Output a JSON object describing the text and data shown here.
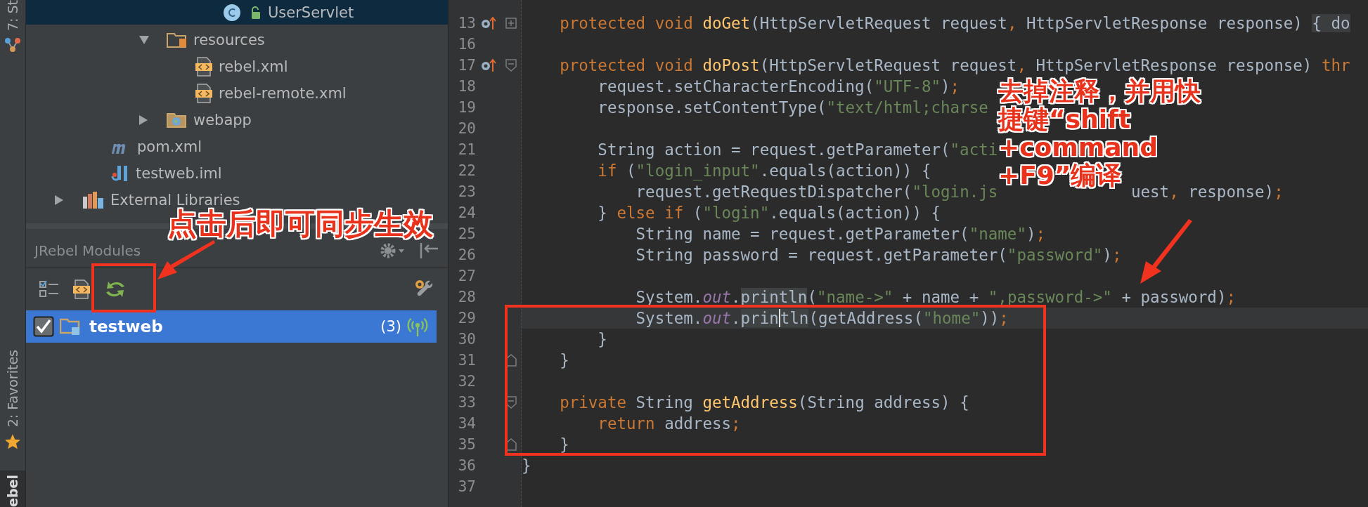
{
  "tool_strip": [
    {
      "label": "7: St",
      "selected": false
    },
    {
      "label": "2: Favorites",
      "selected": false
    },
    {
      "label": "ebel",
      "selected": true
    }
  ],
  "project_tree": [
    {
      "children": [
        {
          "children": [
            {
              "children": [
                {
                  "children": [
                    {
                      "children": [
                        {
                          "label": "UserServlet",
                          "kind": "class",
                          "selected": true
                        }
                      ]
                    }
                  ]
                },
                {
                  "label": "resources",
                  "kind": "resources",
                  "expanded": true,
                  "selected": false,
                  "children": [
                    {
                      "label": "rebel.xml",
                      "kind": "xml",
                      "selected": false
                    },
                    {
                      "label": "rebel-remote.xml",
                      "kind": "xml",
                      "selected": false
                    }
                  ]
                },
                {
                  "label": "webapp",
                  "kind": "web",
                  "expanded": false,
                  "selected": false
                }
              ]
            }
          ]
        },
        {
          "label": "pom.xml",
          "kind": "maven",
          "selected": false
        },
        {
          "label": "testweb.iml",
          "kind": "iml",
          "selected": false
        }
      ]
    },
    {
      "label": "External Libraries",
      "kind": "libraries",
      "expanded": false,
      "selected": false
    }
  ],
  "modules_panel": {
    "title": "JRebel Modules",
    "modules": [
      {
        "name": "testweb",
        "count": "(3)",
        "checked": true,
        "selected": true
      }
    ]
  },
  "editor": {
    "lines": [
      {
        "number": "13",
        "override": true,
        "fold": {
          "kind": "plus"
        },
        "tokens": [
          {
            "kind": "kw",
            "t": "    protected void "
          },
          {
            "kind": "decl",
            "t": "doGet"
          },
          {
            "kind": "p",
            "t": "(HttpServletRequest request"
          },
          {
            "kind": "kw",
            "t": ", "
          },
          {
            "kind": "p",
            "t": "HttpServletResponse response) "
          },
          {
            "kind": "folded",
            "t": "{ do"
          }
        ]
      },
      {
        "number": "16"
      },
      {
        "number": "17",
        "override": true,
        "fold": {
          "kind": "start"
        },
        "tokens": [
          {
            "kind": "kw",
            "t": "    protected void "
          },
          {
            "kind": "decl",
            "t": "doPost"
          },
          {
            "kind": "p",
            "t": "(HttpServletRequest request"
          },
          {
            "kind": "kw",
            "t": ", "
          },
          {
            "kind": "p",
            "t": "HttpServletResponse response) "
          },
          {
            "kind": "kw",
            "t": "thr"
          }
        ]
      },
      {
        "number": "18",
        "tokens": [
          {
            "kind": "p",
            "t": "        request.setCharacterEncoding("
          },
          {
            "kind": "str",
            "t": "\"UTF-8\""
          },
          {
            "kind": "p",
            "t": ")"
          },
          {
            "kind": "kw",
            "t": ";"
          }
        ]
      },
      {
        "number": "19",
        "tokens": [
          {
            "kind": "p",
            "t": "        response.setContentType("
          },
          {
            "kind": "str",
            "t": "\"text/html;charse"
          }
        ]
      },
      {
        "number": "20"
      },
      {
        "number": "21",
        "tokens": [
          {
            "kind": "p",
            "t": "        String action = request.getParameter("
          },
          {
            "kind": "str",
            "t": "\"acti"
          }
        ]
      },
      {
        "number": "22",
        "tokens": [
          {
            "kind": "kw",
            "t": "        if "
          },
          {
            "kind": "p",
            "t": "("
          },
          {
            "kind": "str",
            "t": "\"login_input\""
          },
          {
            "kind": "p",
            "t": ".equals(action)) {"
          }
        ]
      },
      {
        "number": "23",
        "tokens": [
          {
            "kind": "p",
            "t": "            request.getRequestDispatcher("
          },
          {
            "kind": "str",
            "t": "\"login.js"
          }
        ],
        "tail": [
          {
            "kind": "p",
            "t": "uest"
          },
          {
            "kind": "kw",
            "t": ", "
          },
          {
            "kind": "p",
            "t": "response)"
          },
          {
            "kind": "kw",
            "t": ";"
          }
        ]
      },
      {
        "number": "24",
        "tokens": [
          {
            "kind": "p",
            "t": "        } "
          },
          {
            "kind": "kw",
            "t": "else if "
          },
          {
            "kind": "p",
            "t": "("
          },
          {
            "kind": "str",
            "t": "\"login\""
          },
          {
            "kind": "p",
            "t": ".equals(action)) {"
          }
        ]
      },
      {
        "number": "25",
        "tokens": [
          {
            "kind": "p",
            "t": "            String name = request.getParameter("
          },
          {
            "kind": "str",
            "t": "\"name\""
          },
          {
            "kind": "p",
            "t": ")"
          },
          {
            "kind": "kw",
            "t": ";"
          }
        ]
      },
      {
        "number": "26",
        "tokens": [
          {
            "kind": "p",
            "t": "            String password = request.getParameter("
          },
          {
            "kind": "str",
            "t": "\"password\""
          },
          {
            "kind": "p",
            "t": ")"
          },
          {
            "kind": "kw",
            "t": ";"
          }
        ]
      },
      {
        "number": "27"
      },
      {
        "number": "28",
        "tokens": [
          {
            "kind": "p",
            "t": "            System."
          },
          {
            "kind": "field",
            "t": "out"
          },
          {
            "kind": "p",
            "t": "."
          },
          {
            "kind": "match",
            "t": "println"
          },
          {
            "kind": "p",
            "t": "("
          },
          {
            "kind": "str",
            "t": "\"name->\""
          },
          {
            "kind": "p",
            "t": " + name + "
          },
          {
            "kind": "str",
            "t": "\",password->\""
          },
          {
            "kind": "p",
            "t": " + password)"
          },
          {
            "kind": "kw",
            "t": ";"
          }
        ]
      },
      {
        "number": "29",
        "current": true,
        "tokens": [
          {
            "kind": "p",
            "t": "            System."
          },
          {
            "kind": "field",
            "t": "out"
          },
          {
            "kind": "p",
            "t": "."
          },
          {
            "kind": "match",
            "t": "prin"
          },
          {
            "kind": "match",
            "t": "tln",
            "caret": true
          },
          {
            "kind": "p",
            "t": "(getAddress("
          },
          {
            "kind": "str",
            "t": "\"home\""
          },
          {
            "kind": "p",
            "t": "))"
          },
          {
            "kind": "kw",
            "t": ";"
          }
        ]
      },
      {
        "number": "30",
        "tokens": [
          {
            "kind": "p",
            "t": "        }"
          }
        ]
      },
      {
        "number": "31",
        "fold": {
          "kind": "end"
        },
        "tokens": [
          {
            "kind": "p",
            "t": "    }"
          }
        ]
      },
      {
        "number": "32"
      },
      {
        "number": "33",
        "fold": {
          "kind": "start"
        },
        "tokens": [
          {
            "kind": "kw",
            "t": "    private "
          },
          {
            "kind": "p",
            "t": "String "
          },
          {
            "kind": "decl",
            "t": "getAddress"
          },
          {
            "kind": "p",
            "t": "(String address) {"
          }
        ]
      },
      {
        "number": "34",
        "tokens": [
          {
            "kind": "kw",
            "t": "        return "
          },
          {
            "kind": "p",
            "t": "address"
          },
          {
            "kind": "kw",
            "t": ";"
          }
        ]
      },
      {
        "number": "35",
        "fold": {
          "kind": "end"
        },
        "tokens": [
          {
            "kind": "p",
            "t": "    }"
          }
        ]
      },
      {
        "number": "36",
        "tokens": [
          {
            "kind": "p",
            "t": "}"
          }
        ]
      },
      {
        "number": "37"
      }
    ]
  },
  "annotations": [
    {
      "lines": [
        "点击后即可同步生效"
      ]
    },
    {
      "lines": [
        "去掉注释，并用快",
        "捷键“shift",
        "+command",
        "+F9”编译"
      ]
    }
  ]
}
